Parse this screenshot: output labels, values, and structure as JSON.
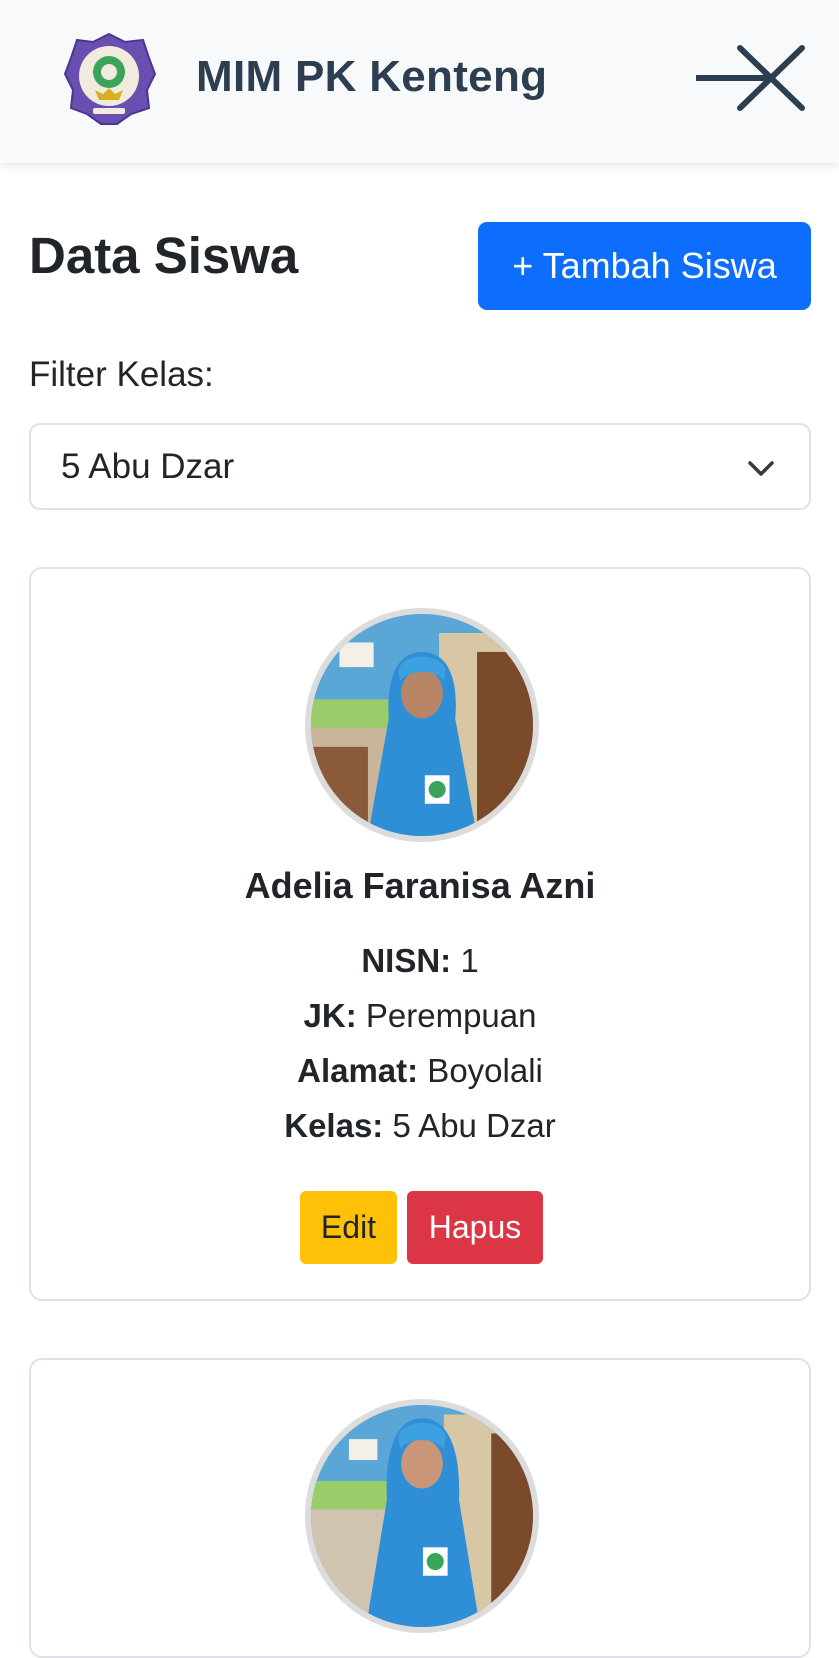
{
  "header": {
    "brand": "MIM PK Kenteng",
    "logo_icon": "school-emblem-icon",
    "close_icon": "close-menu-icon"
  },
  "page": {
    "title": "Data Siswa",
    "add_button_label": "+ Tambah Siswa",
    "filter_label": "Filter Kelas:",
    "filter_selected": "5 Abu Dzar"
  },
  "students": [
    {
      "name": "Adelia Faranisa Azni",
      "nisn_label": "NISN:",
      "nisn": " 1",
      "jk_label": "JK:",
      "jk": " Perempuan",
      "alamat_label": "Alamat:",
      "alamat": " Boyolali",
      "kelas_label": "Kelas:",
      "kelas": " 5 Abu Dzar",
      "edit_label": "Edit",
      "delete_label": "Hapus"
    }
  ],
  "colors": {
    "primary": "#0d6efd",
    "warning": "#ffc107",
    "danger": "#dc3545",
    "brand_text": "#2c3e50"
  }
}
